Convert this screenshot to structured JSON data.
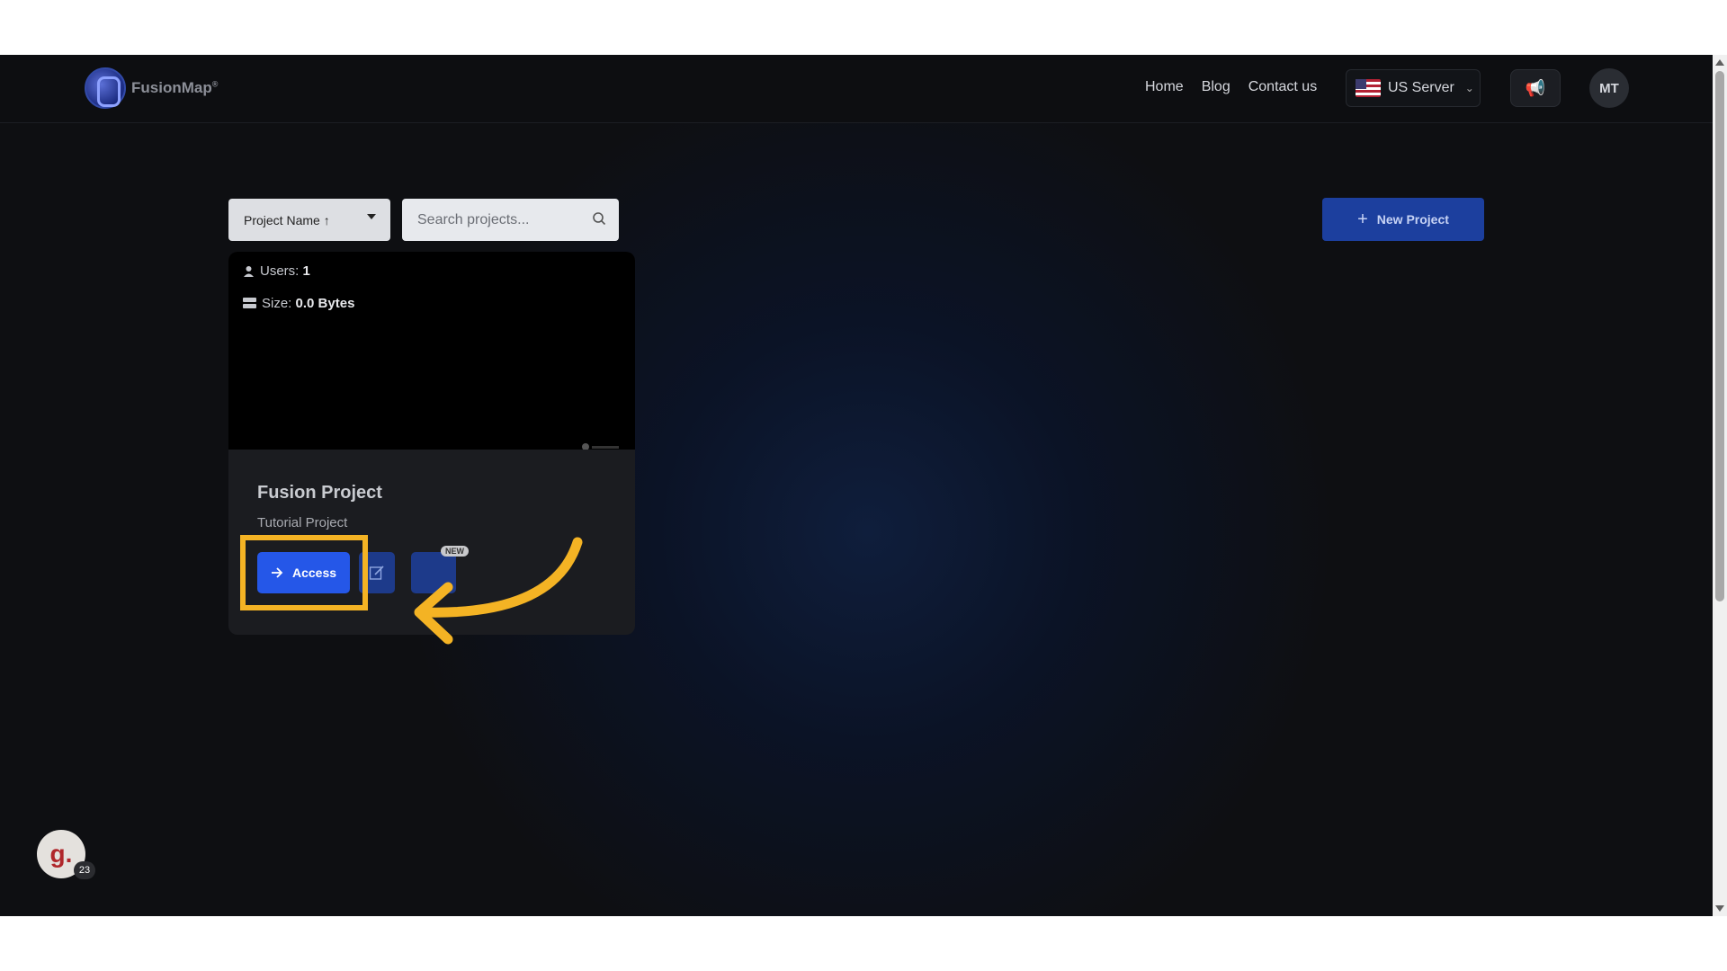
{
  "header": {
    "logo_text": "FusionMap",
    "logo_sup": "®",
    "nav": [
      "Home",
      "Blog",
      "Contact us"
    ],
    "server_label": "US Server",
    "avatar_initials": "MT"
  },
  "toolbar": {
    "sort_label": "Project Name ↑",
    "search_placeholder": "Search projects...",
    "new_project_label": "New Project"
  },
  "project_card": {
    "users_label": "Users:",
    "users_value": "1",
    "size_label": "Size:",
    "size_value": "0.0 Bytes",
    "title": "Fusion Project",
    "subtitle": "Tutorial Project",
    "access_label": "Access",
    "badge": "NEW"
  },
  "widget": {
    "letter": "g.",
    "count": "23"
  },
  "colors": {
    "accent": "#2557e8",
    "highlight": "#f4b324"
  }
}
